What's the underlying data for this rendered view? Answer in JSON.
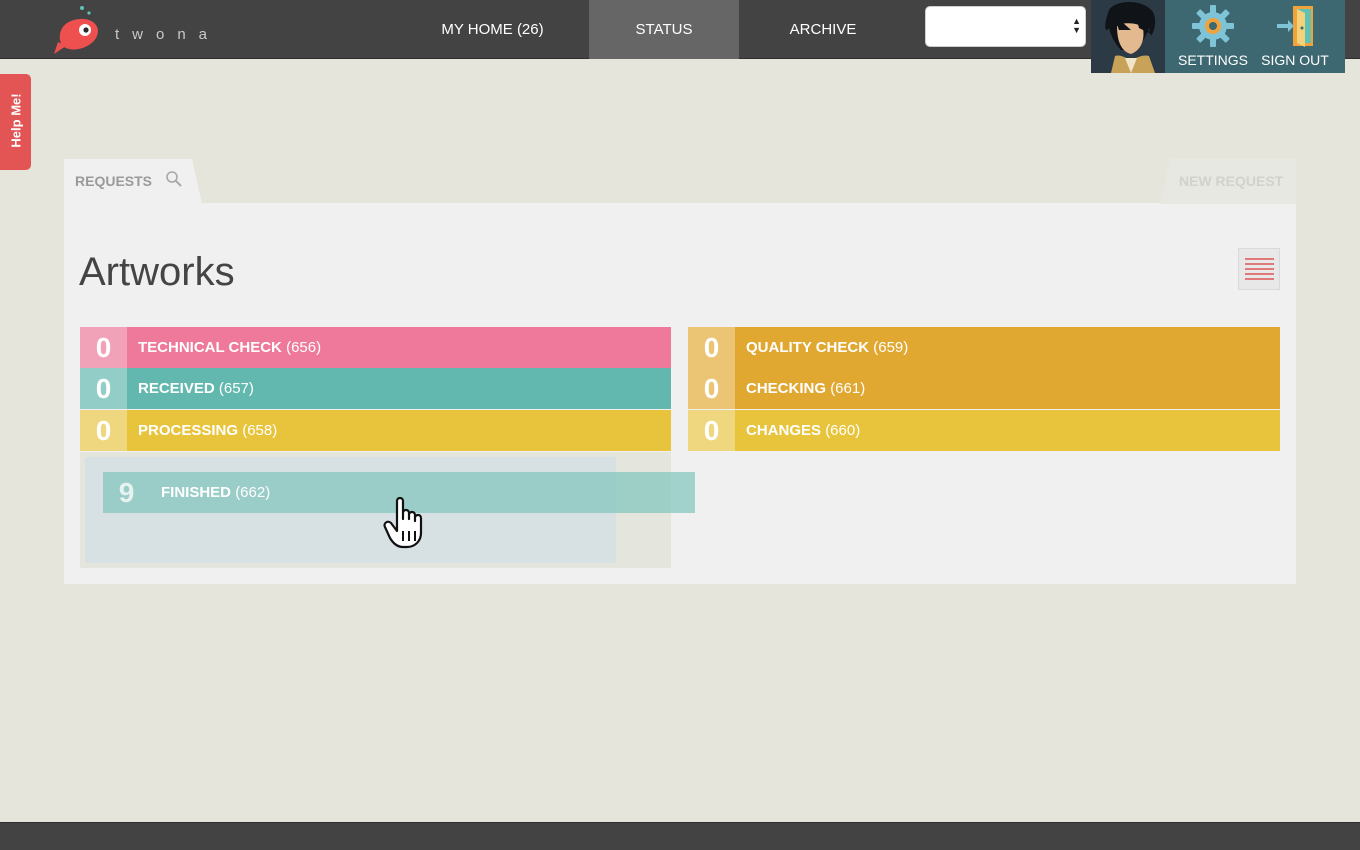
{
  "header": {
    "logo_text": "twona",
    "nav": [
      {
        "label": "MY HOME (26)"
      },
      {
        "label": "STATUS"
      },
      {
        "label": "ARCHIVE"
      }
    ],
    "select_value": "",
    "settings_label": "SETTINGS",
    "signout_label": "SIGN OUT"
  },
  "help_tab": {
    "label": "Help Me!"
  },
  "tabs": {
    "requests_label": "REQUESTS",
    "new_request_label": "NEW REQUEST"
  },
  "page": {
    "title": "Artworks"
  },
  "status_columns": [
    {
      "rows": [
        {
          "count": "0",
          "name": "TECHNICAL CHECK",
          "id": "(656)",
          "color": "#ee799a",
          "count_color": "#f2a2b8"
        },
        {
          "count": "0",
          "name": "RECEIVED",
          "id": "(657)",
          "color": "#62b8ae",
          "count_color": "#92cec7"
        },
        {
          "count": "0",
          "name": "PROCESSING",
          "id": "(658)",
          "color": "#e8c43c",
          "count_color": "#efd77f"
        }
      ]
    },
    {
      "rows": [
        {
          "count": "0",
          "name": "QUALITY CHECK",
          "id": "(659)",
          "color": "#e0a831",
          "count_color": "#ebc474"
        },
        {
          "count": "0",
          "name": "CHECKING",
          "id": "(661)",
          "color": "#e0a831",
          "count_color": "#ebc474"
        },
        {
          "count": "0",
          "name": "CHANGES",
          "id": "(660)",
          "color": "#e8c43c",
          "count_color": "#efd77f"
        }
      ]
    }
  ],
  "dragged_item": {
    "count": "9",
    "name": "FINISHED",
    "id": "(662)"
  },
  "colors": {
    "topbar": "#434343",
    "active_nav": "#666666",
    "user_panel": "#3d6771",
    "help_tab": "#e35454",
    "background": "#e5e5dc",
    "panel": "#f0f0f0"
  },
  "icons": {
    "logo": "fish-logo-icon",
    "settings": "gear-icon",
    "signout": "door-exit-icon",
    "search": "search-icon",
    "list_view": "list-view-icon",
    "cursor": "hand-grab-cursor-icon"
  }
}
